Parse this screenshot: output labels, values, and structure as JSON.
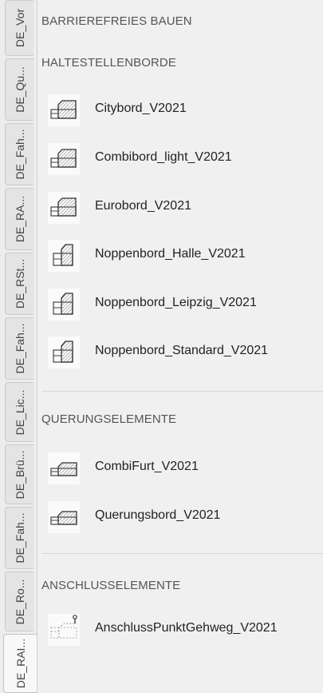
{
  "tabs": [
    {
      "label": "DE_Vor"
    },
    {
      "label": "DE_Qu..."
    },
    {
      "label": "DE_Fah..."
    },
    {
      "label": "DE_RA..."
    },
    {
      "label": "DE_RSt..."
    },
    {
      "label": "DE_Fah..."
    },
    {
      "label": "DE_Lic..."
    },
    {
      "label": "DE_Brü..."
    },
    {
      "label": "DE_Fah..."
    },
    {
      "label": "DE_Ro..."
    },
    {
      "label": "DE_RAI..."
    }
  ],
  "header": {
    "title": "BARRIEREFREIES BAUEN"
  },
  "sections": [
    {
      "title": "HALTESTELLENBORDE",
      "items": [
        {
          "label": "Citybord_V2021",
          "icon": "curb-block-icon"
        },
        {
          "label": "Combibord_light_V2021",
          "icon": "curb-block-icon"
        },
        {
          "label": "Eurobord_V2021",
          "icon": "curb-block-icon"
        },
        {
          "label": "Noppenbord_Halle_V2021",
          "icon": "curb-tall-icon"
        },
        {
          "label": "Noppenbord_Leipzig_V2021",
          "icon": "curb-tall-icon"
        },
        {
          "label": "Noppenbord_Standard_V2021",
          "icon": "curb-tall-icon"
        }
      ]
    },
    {
      "title": "QUERUNGSELEMENTE",
      "items": [
        {
          "label": "CombiFurt_V2021",
          "icon": "curb-flat-icon"
        },
        {
          "label": "Querungsbord_V2021",
          "icon": "curb-flat-icon"
        }
      ]
    },
    {
      "title": "ANSCHLUSSELEMENTE",
      "items": [
        {
          "label": "AnschlussPunktGehweg_V2021",
          "icon": "connection-point-icon"
        }
      ]
    }
  ]
}
